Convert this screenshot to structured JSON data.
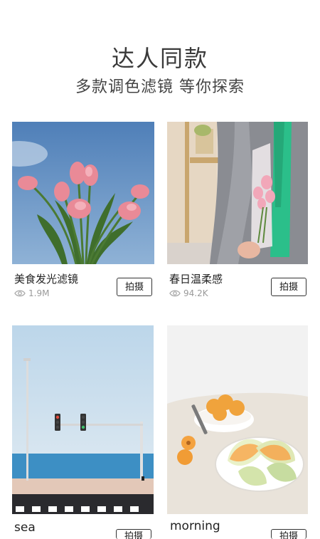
{
  "header": {
    "title": "达人同款",
    "subtitle": "多款调色滤镜 等你探索"
  },
  "filters": [
    {
      "name": "美食发光滤镜",
      "views": "1.9M",
      "action_label": "拍摄",
      "image": "pink tulips against blue sky"
    },
    {
      "name": "春日温柔感",
      "views": "94.2K",
      "action_label": "拍摄",
      "image": "person in grey blazer holding pink tulip bouquet"
    },
    {
      "name": "sea",
      "views": "",
      "action_label": "拍摄",
      "image": "traffic light by the sea under pale blue sky"
    },
    {
      "name": "morning",
      "views": "",
      "action_label": "拍摄",
      "image": "sliced melon and apricots on linen table"
    }
  ],
  "icons": {
    "views": "eye-icon"
  }
}
